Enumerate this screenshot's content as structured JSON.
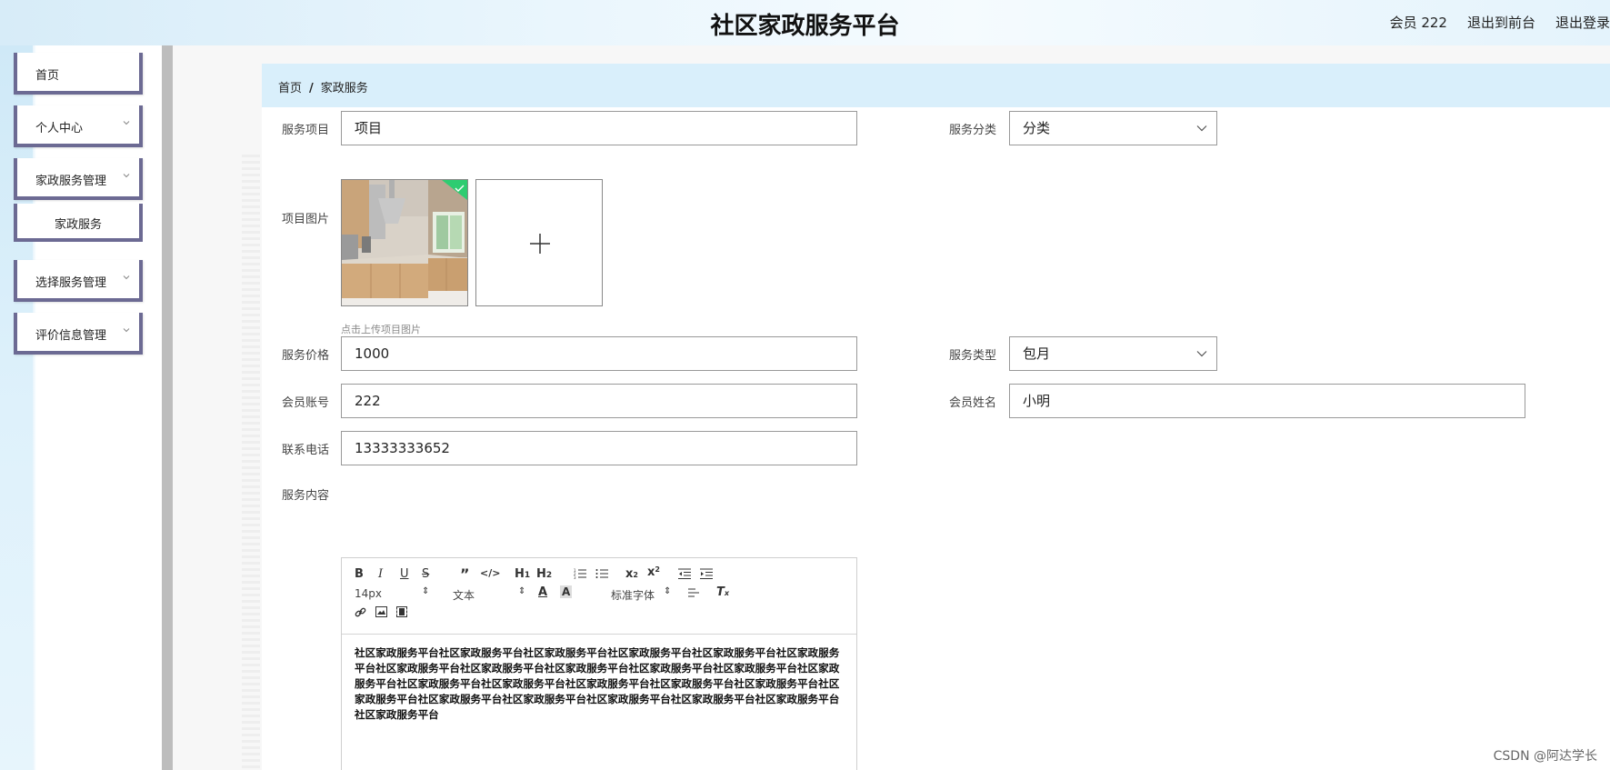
{
  "header": {
    "title": "社区家政服务平台",
    "member_label": "会员 222",
    "back_front_label": "退出到前台",
    "logout_label": "退出登录"
  },
  "sidebar": {
    "items": [
      {
        "label": "首页"
      },
      {
        "label": "个人中心"
      },
      {
        "label": "家政服务管理"
      },
      {
        "label": "家政服务"
      },
      {
        "label": "选择服务管理"
      },
      {
        "label": "评价信息管理"
      }
    ]
  },
  "breadcrumb": {
    "home": "首页",
    "separator": "/",
    "current": "家政服务"
  },
  "form": {
    "service_item": {
      "label": "服务项目",
      "value": "项目"
    },
    "service_category": {
      "label": "服务分类",
      "value": "分类"
    },
    "project_image": {
      "label": "项目图片",
      "hint": "点击上传项目图片"
    },
    "price": {
      "label": "服务价格",
      "value": "1000"
    },
    "service_type": {
      "label": "服务类型",
      "value": "包月"
    },
    "member_account": {
      "label": "会员账号",
      "value": "222"
    },
    "member_name": {
      "label": "会员姓名",
      "value": "小明"
    },
    "phone": {
      "label": "联系电话",
      "value": "13333333652"
    },
    "content": {
      "label": "服务内容",
      "text": "社区家政服务平台社区家政服务平台社区家政服务平台社区家政服务平台社区家政服务平台社区家政服务平台社区家政服务平台社区家政服务平台社区家政服务平台社区家政服务平台社区家政服务平台社区家政服务平台社区家政服务平台社区家政服务平台社区家政服务平台社区家政服务平台社区家政服务平台社区家政服务平台社区家政服务平台社区家政服务平台社区家政服务平台社区家政服务平台社区家政服务平台社区家政服务平台"
    }
  },
  "editor": {
    "font_size": "14px",
    "paragraph": "文本",
    "font_family": "标准字体"
  },
  "watermark": "CSDN @阿达学长",
  "colors": {
    "menu_border": "#6c6a93",
    "breadcrumb_bg": "#d9effb",
    "check_badge": "#2ecc71"
  }
}
